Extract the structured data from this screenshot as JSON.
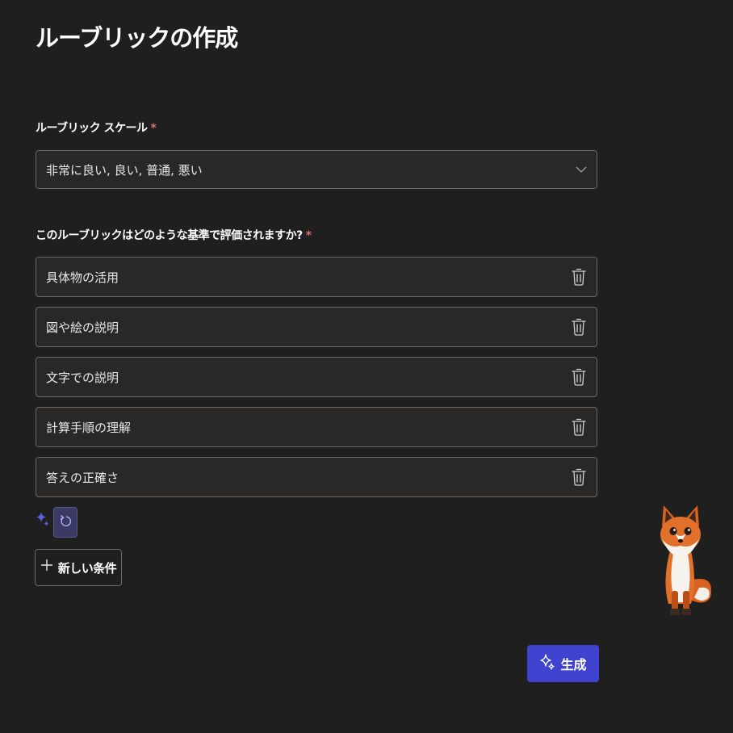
{
  "page": {
    "title": "ルーブリックの作成"
  },
  "scale": {
    "label": "ルーブリック スケール",
    "required_mark": "*",
    "value": "非常に良い, 良い, 普通, 悪い"
  },
  "criteria": {
    "label": "このルーブリックはどのような基準で評価されますか?",
    "required_mark": "*",
    "items": [
      {
        "value": "具体物の活用"
      },
      {
        "value": "図や絵の説明"
      },
      {
        "value": "文字での説明"
      },
      {
        "value": "計算手順の理解"
      },
      {
        "value": "答えの正確さ"
      }
    ]
  },
  "actions": {
    "add_label": "新しい条件",
    "add_icon": "plus-icon",
    "generate_label": "生成",
    "generate_icon": "sparkle-icon",
    "refresh_icon": "refresh-icon"
  },
  "colors": {
    "background": "#1f1f1f",
    "field": "#292827",
    "border": "#6b6a69",
    "accent": "#4043cf",
    "required": "#e07070"
  },
  "decorations": {
    "mascot": "fox-mascot"
  }
}
